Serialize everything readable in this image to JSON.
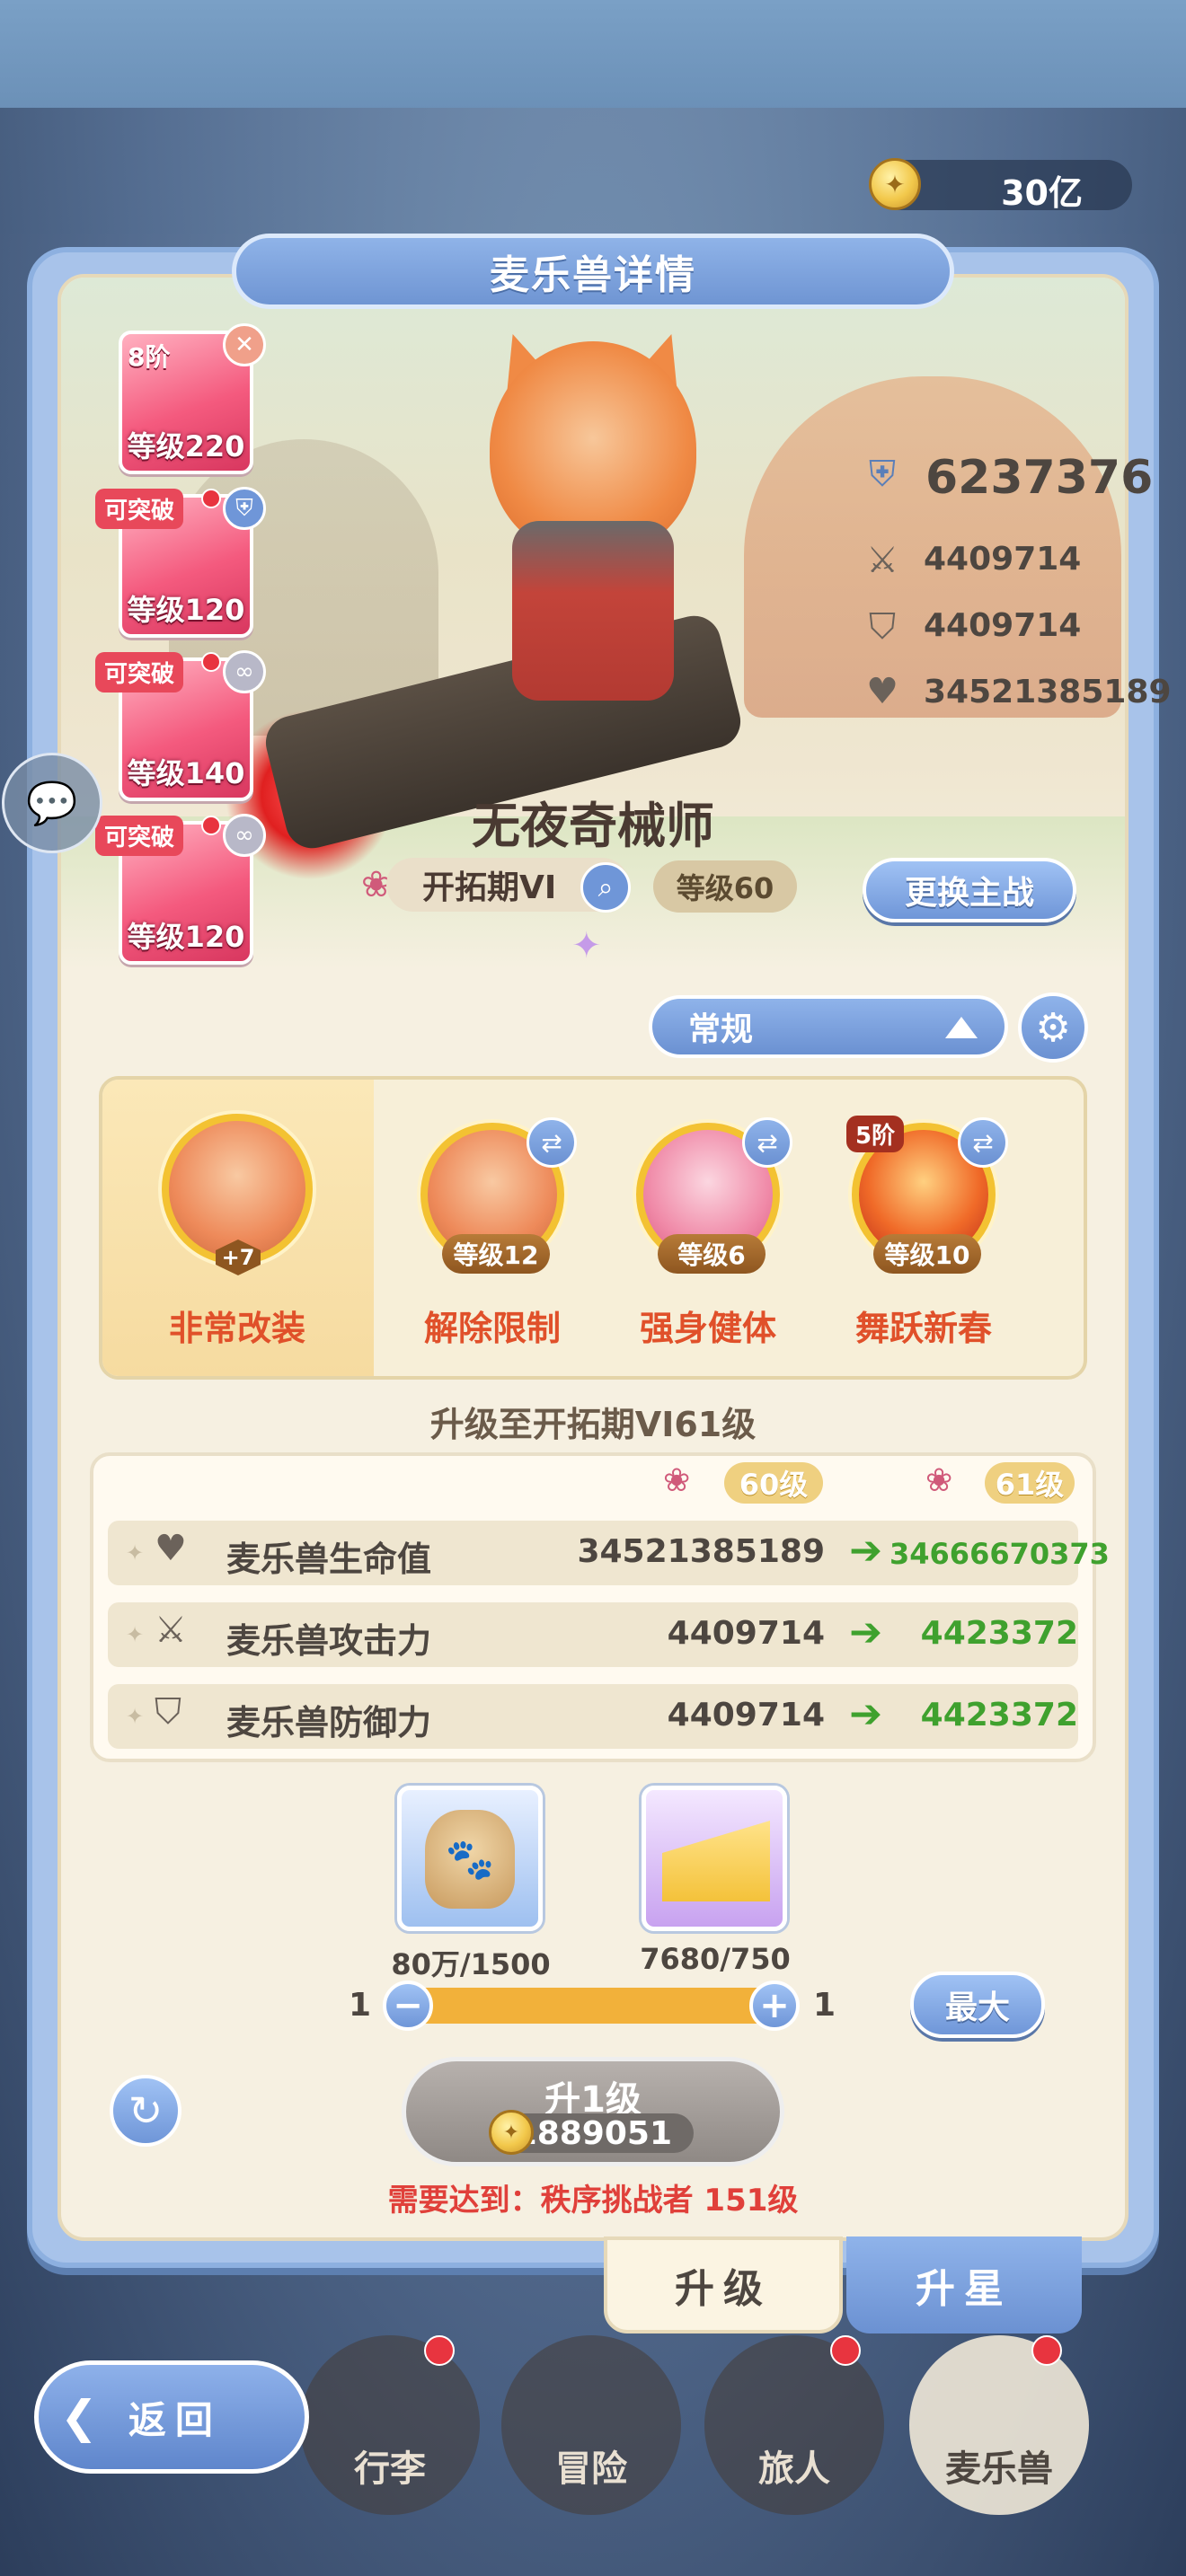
{
  "currency": {
    "amount": "30亿",
    "icon": "coin-icon"
  },
  "panel": {
    "title": "麦乐兽详情"
  },
  "gear": [
    {
      "stage": "8阶",
      "level": "等级220",
      "tag": "",
      "badge_icon": "crossed-swords-icon"
    },
    {
      "stage": "",
      "level": "等级120",
      "tag": "可突破",
      "badge_icon": "shield-icon"
    },
    {
      "stage": "",
      "level": "等级140",
      "tag": "可突破",
      "badge_icon": "link-icon"
    },
    {
      "stage": "",
      "level": "等级120",
      "tag": "可突破",
      "badge_icon": "link-icon"
    }
  ],
  "character": {
    "name": "无夜奇械师",
    "stage": "开拓期VI",
    "level": "等级60",
    "change_button": "更换主战"
  },
  "stats": {
    "power": "6237376",
    "attack": "4409714",
    "defense": "4409714",
    "hp": "34521385189"
  },
  "dropdown": {
    "selected": "常规"
  },
  "skills": [
    {
      "label": "非常改装",
      "badge": "+7",
      "selected": true
    },
    {
      "label": "解除限制",
      "badge": "等级12"
    },
    {
      "label": "强身健体",
      "badge": "等级6"
    },
    {
      "label": "舞跃新春",
      "badge": "等级10",
      "stage": "5阶"
    }
  ],
  "upgrade": {
    "title": "升级至开拓期VI61级",
    "from_level": "60级",
    "to_level": "61级",
    "rows": [
      {
        "name": "麦乐兽生命值",
        "current": "34521385189",
        "next": "34666670373",
        "icon": "heart-icon"
      },
      {
        "name": "麦乐兽攻击力",
        "current": "4409714",
        "next": "4423372",
        "icon": "crossed-swords-icon"
      },
      {
        "name": "麦乐兽防御力",
        "current": "4409714",
        "next": "4423372",
        "icon": "shield-icon"
      }
    ]
  },
  "materials": [
    {
      "count": "80万/1500",
      "icon": "food-bag-icon"
    },
    {
      "count": "7680/750",
      "icon": "cheese-icon"
    }
  ],
  "slider": {
    "min": "1",
    "max": "1",
    "max_button": "最大"
  },
  "upgrade_button": {
    "label": "升1级",
    "cost": "1889051"
  },
  "requirement": "需要达到：秩序挑战者 151级",
  "tabs": {
    "upgrade": "升级",
    "star": "升星"
  },
  "nav": [
    {
      "label": "行李"
    },
    {
      "label": "冒险"
    },
    {
      "label": "旅人"
    },
    {
      "label": "麦乐兽"
    }
  ],
  "back_button": "返回",
  "colors": {
    "accent_blue": "#6f96d8",
    "gold": "#f2c84b",
    "green": "#3fa12e",
    "red": "#e0403a"
  }
}
